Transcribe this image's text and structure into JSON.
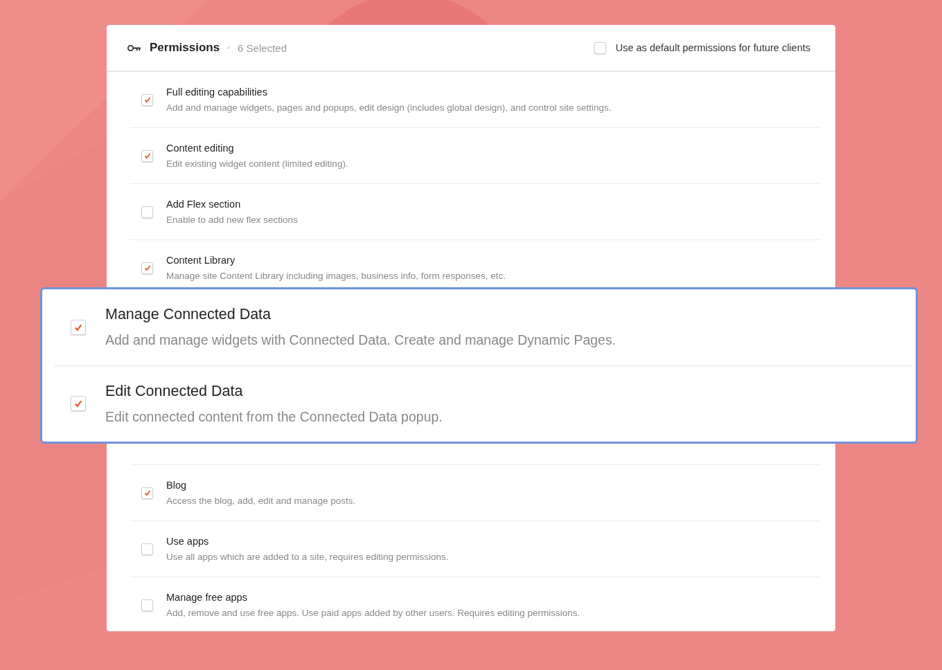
{
  "header": {
    "title": "Permissions",
    "count": "6 Selected",
    "default_option": {
      "label": "Use as default permissions for future clients",
      "checked": false
    }
  },
  "permissions": [
    {
      "title": "Full editing capabilities",
      "description": "Add and manage widgets, pages and popups, edit design (includes global design), and control site settings.",
      "checked": true
    },
    {
      "title": "Content editing",
      "description": "Edit existing widget content (limited editing).",
      "checked": true
    },
    {
      "title": "Add Flex section",
      "description": "Enable to add new flex sections",
      "checked": false
    },
    {
      "title": "Content Library",
      "description": "Manage site Content Library including images, business info, form responses, etc.",
      "checked": true
    }
  ],
  "highlighted_permissions": [
    {
      "title": "Manage Connected Data",
      "description": "Add and manage widgets with Connected Data. Create and manage Dynamic Pages.",
      "checked": true
    },
    {
      "title": "Edit Connected Data",
      "description": "Edit connected content from the Connected Data popup.",
      "checked": true
    }
  ],
  "more_permissions": [
    {
      "title": "Blog",
      "description": "Access the blog, add, edit and manage posts.",
      "checked": true
    },
    {
      "title": "Use apps",
      "description": "Use all apps which are added to a site, requires editing permissions.",
      "checked": false
    },
    {
      "title": "Manage free apps",
      "description": "Add, remove and use free apps. Use paid apps added by other users. Requires editing permissions.",
      "checked": false
    }
  ]
}
